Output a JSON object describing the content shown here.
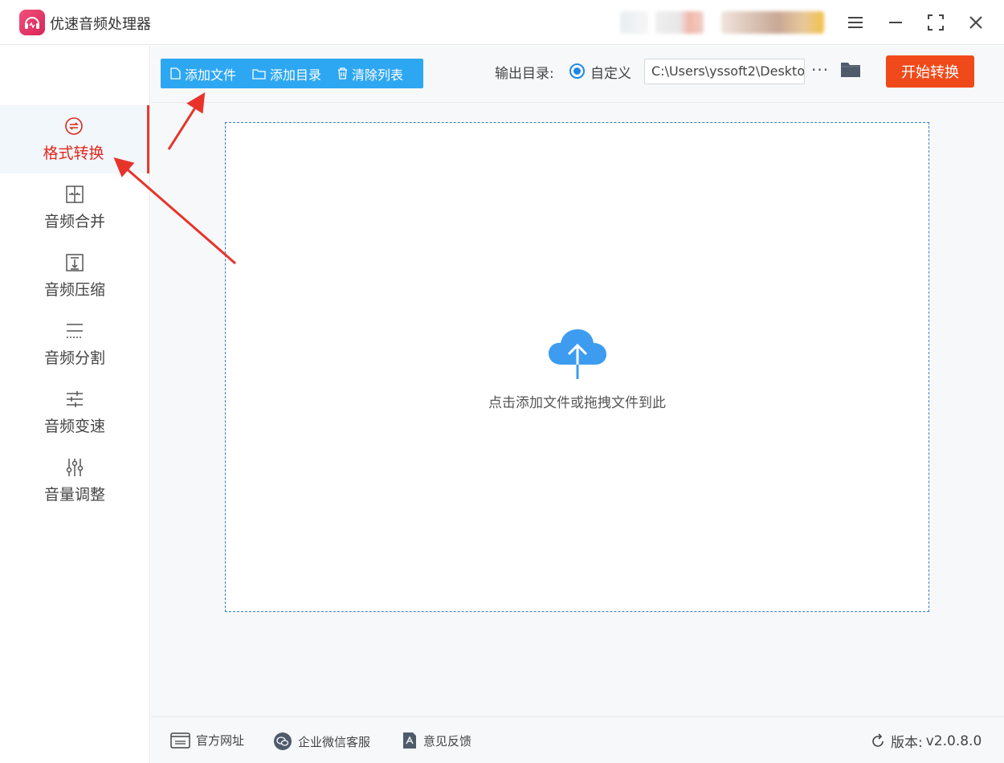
{
  "app": {
    "title": "优速音频处理器",
    "brand_color": "#e0285a"
  },
  "window_controls": {
    "menu": "menu-icon",
    "minimize": "minimize-icon",
    "maximize": "maximize-icon",
    "close": "close-icon"
  },
  "sidebar": {
    "active_color": "#e0281c",
    "items": [
      {
        "label": "格式转换",
        "icon": "convert-icon",
        "active": true
      },
      {
        "label": "音频合并",
        "icon": "merge-icon",
        "active": false
      },
      {
        "label": "音频压缩",
        "icon": "compress-icon",
        "active": false
      },
      {
        "label": "音频分割",
        "icon": "split-icon",
        "active": false
      },
      {
        "label": "音频变速",
        "icon": "speed-icon",
        "active": false
      },
      {
        "label": "音量调整",
        "icon": "volume-icon",
        "active": false
      }
    ]
  },
  "toolbar": {
    "add_file": "添加文件",
    "add_dir": "添加目录",
    "clear_list": "清除列表",
    "color": "#2ea7f2"
  },
  "output": {
    "label": "输出目录:",
    "option_custom": "自定义",
    "path": "C:\\Users\\yssoft2\\Deskto",
    "more": "···",
    "start_button": "开始转换",
    "start_color": "#f04a1a"
  },
  "dropzone": {
    "hint": "点击添加文件或拖拽文件到此",
    "icon": "cloud-upload-icon"
  },
  "footer": {
    "website": "官方网址",
    "wechat": "企业微信客服",
    "feedback": "意见反馈",
    "version_label": "版本:",
    "version": "v2.0.8.0"
  }
}
